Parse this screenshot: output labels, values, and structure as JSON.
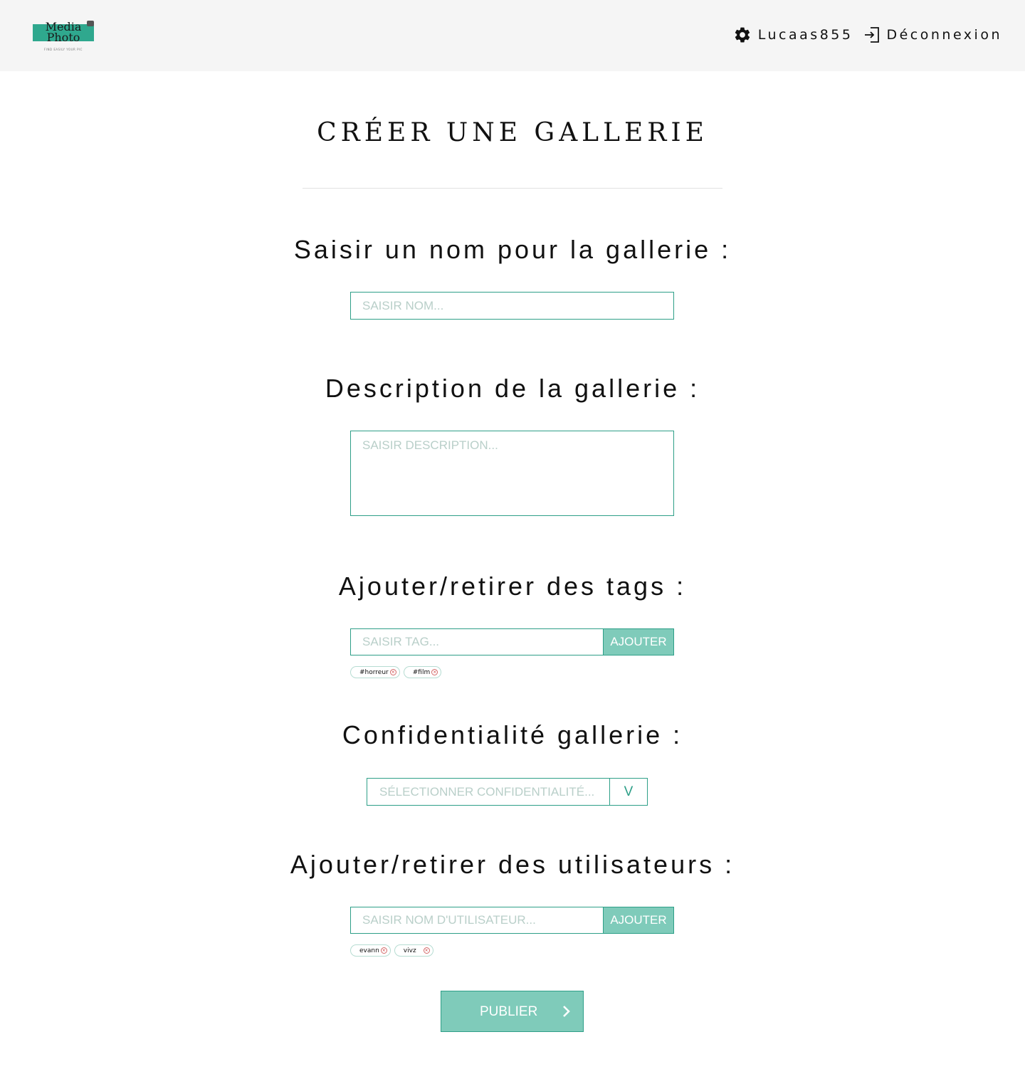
{
  "header": {
    "logo_line1": "Media",
    "logo_line2": "Photo",
    "logo_tagline": "FIND EASILY YOUR PIC",
    "settings_icon": "gear-icon",
    "username": "Lucaas855",
    "logout_icon": "logout-icon",
    "logout_label": "Déconnexion"
  },
  "page": {
    "title": "Créer une gallerie"
  },
  "name_section": {
    "label": "Saisir un nom pour la gallerie :",
    "placeholder": "Saisir nom...",
    "value": ""
  },
  "description_section": {
    "label": "Description de la gallerie :",
    "placeholder": "Saisir description...",
    "value": ""
  },
  "tags_section": {
    "label": "Ajouter/retirer des tags :",
    "placeholder": "Saisir tag...",
    "add_label": "AJOUTER",
    "tags": [
      {
        "label": "#horreur"
      },
      {
        "label": "#film"
      }
    ]
  },
  "privacy_section": {
    "label": "Confidentialité gallerie :",
    "selected": "SÉLECTIONNER CONFIDENTIALITÉ...",
    "arrow": "V"
  },
  "users_section": {
    "label": "Ajouter/retirer des utilisateurs :",
    "placeholder": "Saisir nom d'utilisateur...",
    "add_label": "AJOUTER",
    "users": [
      {
        "label": "evann"
      },
      {
        "label": "vivz"
      }
    ]
  },
  "publish": {
    "label": "PUBLIER",
    "icon": "chevron-right-icon"
  },
  "colors": {
    "accent": "#2e9f88",
    "button_fill": "#7fcbba",
    "header_bg": "#f5f5f5",
    "placeholder": "#b9cfc9"
  }
}
